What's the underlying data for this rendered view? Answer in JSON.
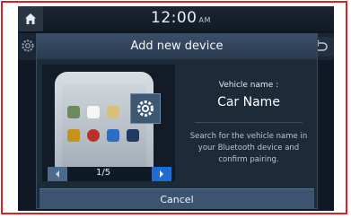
{
  "status": {
    "time": "12:00",
    "ampm": "AM"
  },
  "dialog": {
    "title": "Add new device",
    "vehicle_label": "Vehicle name :",
    "vehicle_name": "Car Name",
    "description": "Search for the vehicle name in your Bluetooth device and confirm pairing.",
    "pager": "1/5",
    "cancel_label": "Cancel"
  },
  "icons": {
    "home": "home-icon",
    "settings": "gear-icon",
    "back": "back-icon",
    "prev": "chevron-left-icon",
    "next": "chevron-right-icon"
  },
  "colors": {
    "accent": "#1f6bd6",
    "background": "#0d1621",
    "dialog": "#1d2a38"
  }
}
